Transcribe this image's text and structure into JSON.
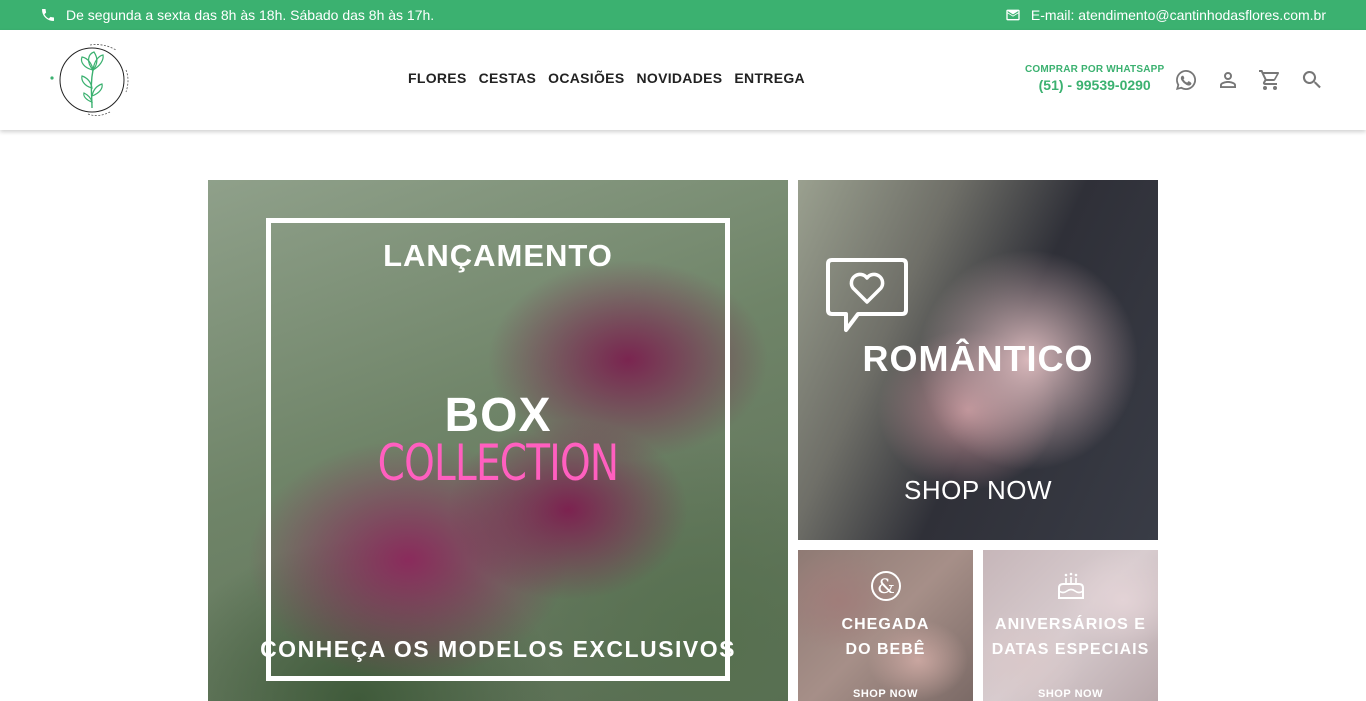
{
  "topbar": {
    "hours": "De segunda a sexta das 8h às 18h. Sábado das 8h às 17h.",
    "email": "E-mail: atendimento@cantinhodasflores.com.br"
  },
  "brand": {
    "name": "Cantinho das Flores",
    "accent_color": "#3bb170"
  },
  "nav": {
    "items": [
      "FLORES",
      "CESTAS",
      "OCASIÕES",
      "NOVIDADES",
      "ENTREGA"
    ]
  },
  "whatsapp": {
    "label": "COMPRAR POR WHATSAPP",
    "phone": "(51) - 99539-0290"
  },
  "header_icons": [
    "whatsapp-icon",
    "user-icon",
    "cart-icon",
    "search-icon"
  ],
  "banners": {
    "main": {
      "title": "LANÇAMENTO",
      "headline": "BOX",
      "headline_accent": "COLLECTION",
      "cta": "CONHEÇA OS MODELOS EXCLUSIVOS",
      "accent_color": "#ff5fbf"
    },
    "romantic": {
      "title": "ROMÂNTICO",
      "cta": "SHOP NOW"
    },
    "baby": {
      "line1": "CHEGADA",
      "line2": "DO BEBÊ",
      "cta": "SHOP NOW"
    },
    "birthday": {
      "line1": "ANIVERSÁRIOS E",
      "line2": "DATAS ESPECIAIS",
      "cta": "SHOP NOW"
    }
  }
}
